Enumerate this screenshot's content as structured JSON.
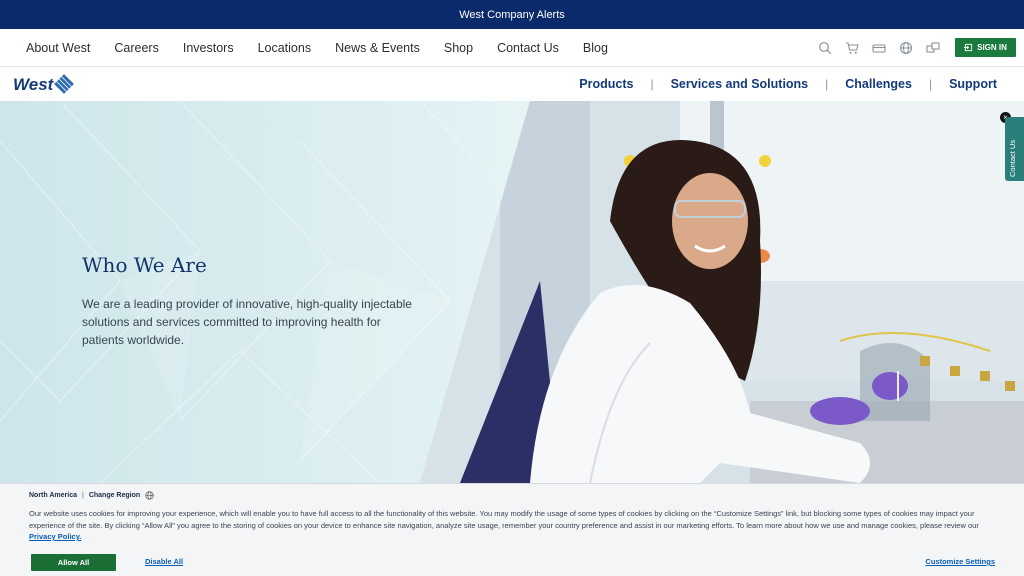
{
  "alert_bar": {
    "text": "West Company Alerts"
  },
  "utility_nav": {
    "links": [
      "About West",
      "Careers",
      "Investors",
      "Locations",
      "News & Events",
      "Shop",
      "Contact Us",
      "Blog"
    ],
    "icons": [
      "search-icon",
      "cart-icon",
      "card-icon",
      "globe-icon",
      "chat-icon"
    ],
    "sign_in": "SIGN IN"
  },
  "brand": {
    "logo_text": "West"
  },
  "main_nav": {
    "links": [
      "Products",
      "Services and Solutions",
      "Challenges",
      "Support"
    ],
    "separator": "|"
  },
  "hero": {
    "title": "Who We Are",
    "body": "We are a leading provider of innovative, high-quality injectable solutions and services committed to improving health for patients worldwide."
  },
  "contact_tab": {
    "label": "Contact Us",
    "close": "×"
  },
  "cookie_banner": {
    "region": "North America",
    "region_sep": "|",
    "change_region": "Change Region",
    "text": "Our website uses cookies for improving your experience, which will enable you to have full access to all the functionality of this website. You may modify the usage of some types of cookies by clicking on the “Customize Settings” link, but blocking some types of cookies may impact your experience of the site. By clicking “Allow All” you agree to the storing of cookies on your device to enhance site navigation, analyze site usage, remember your country preference and assist in our marketing efforts. To learn more about how we use and manage cookies, please review our",
    "privacy_link": "Privacy Policy.",
    "allow_all": "Allow All",
    "disable_all": "Disable All",
    "customize": "Customize Settings"
  },
  "colors": {
    "alert_bg": "#0b2a6b",
    "brand_blue": "#143a7a",
    "sign_in_green": "#1b7a3d",
    "hero_bg": "#dff0f2",
    "link_blue": "#0a5fb4"
  }
}
